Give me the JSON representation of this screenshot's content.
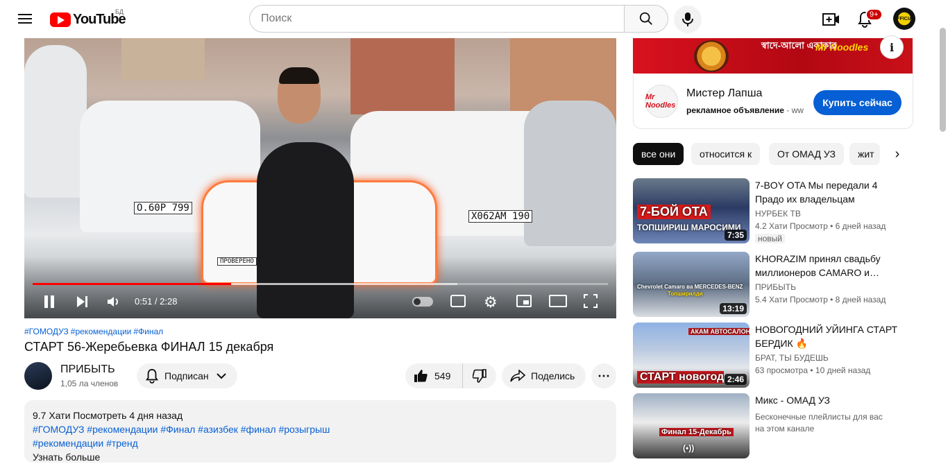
{
  "header": {
    "logo_text": "YouTube",
    "country": "БД",
    "search_placeholder": "Поиск",
    "notifications": "9+",
    "avatar_text": "OFFICIAL"
  },
  "player": {
    "time": "0:51 / 2:28",
    "progress_played": 0.345,
    "progress_buffered": 0.738,
    "plates": [
      "О.60Р 799",
      "Х062АМ 190"
    ],
    "car_label": "ПРОВЕРЕНО"
  },
  "video": {
    "hashtags": [
      "#ГОМОДУЗ",
      "#рекомендации",
      "#Финал"
    ],
    "title": "СТАРТ 56-Жеребьевка ФИНАЛ 15 декабря",
    "channel": "ПРИБЫТЬ",
    "subscribers": "1,05 ла членов",
    "subscribe_label": "Подписан",
    "likes": "549",
    "share_label": "Поделись",
    "more_label": "⋯"
  },
  "description": {
    "meta": "9.7 Хати Посмотреть 4 дня назад",
    "tags_line1": "#ГОМОДУЗ #рекомендации  #Финал #азизбек #финал #розыгрыш",
    "tags_line2": "#рекомендации #тренд",
    "show_more": "Узнать больше"
  },
  "ad": {
    "banner_text": "স্বাদে-আলো একাকার",
    "banner_brand": "Mr Noodles",
    "logo_text": "Mr Noodles",
    "name": "Мистер Лапша",
    "sponsored": "рекламное объявление",
    "url": "ww",
    "cta": "Купить сейчас",
    "info": "i"
  },
  "chips": [
    "все они",
    "относится к",
    "От ОМАД УЗ",
    "жит"
  ],
  "recommendations": [
    {
      "title": "7-BOY OTA Мы передали 4 Прадо их владельцам",
      "channel": "НУРБЕК ТВ",
      "meta": "4.2 Хати Просмотр  •  6 дней назад",
      "badge": "новый",
      "duration": "7:35",
      "thumb_text": "7-БОЙ ОТА",
      "thumb_text2": "ТОПШИРИШ МАРОСИМИ"
    },
    {
      "title": "KHORAZIM принял свадьбу миллионеров CAMARO и…",
      "channel": "ПРИБЫТЬ",
      "meta": "5.4 Хати Просмотр  •  8 дней назад",
      "duration": "13:19",
      "thumb_text": "Chevrolet Camaro ва MERCEDES-BENZ",
      "thumb_text2": "Топширилди"
    },
    {
      "title": "НОВОГОДНИЙ УЙИНГА СТАРТ БЕРДИК 🔥",
      "channel": "БРАТ, ТЫ БУДЕШЬ",
      "meta": "63 просмотра  •  10 дней назад",
      "duration": "2:46",
      "thumb_text": "СТАРТ новогодний",
      "thumb_text2": "АКАМ АВТОСАЛОН"
    },
    {
      "title": "Микс - ОМАД УЗ",
      "channel": "Бесконечные плейлисты для вас",
      "meta": "на этом канале",
      "thumb_text": "Финал 15-Декабрь",
      "thumb_text2": "(•))"
    }
  ],
  "colors": {
    "accent": "#ff0000",
    "link": "#065fd4",
    "cta": "#065fd4"
  }
}
